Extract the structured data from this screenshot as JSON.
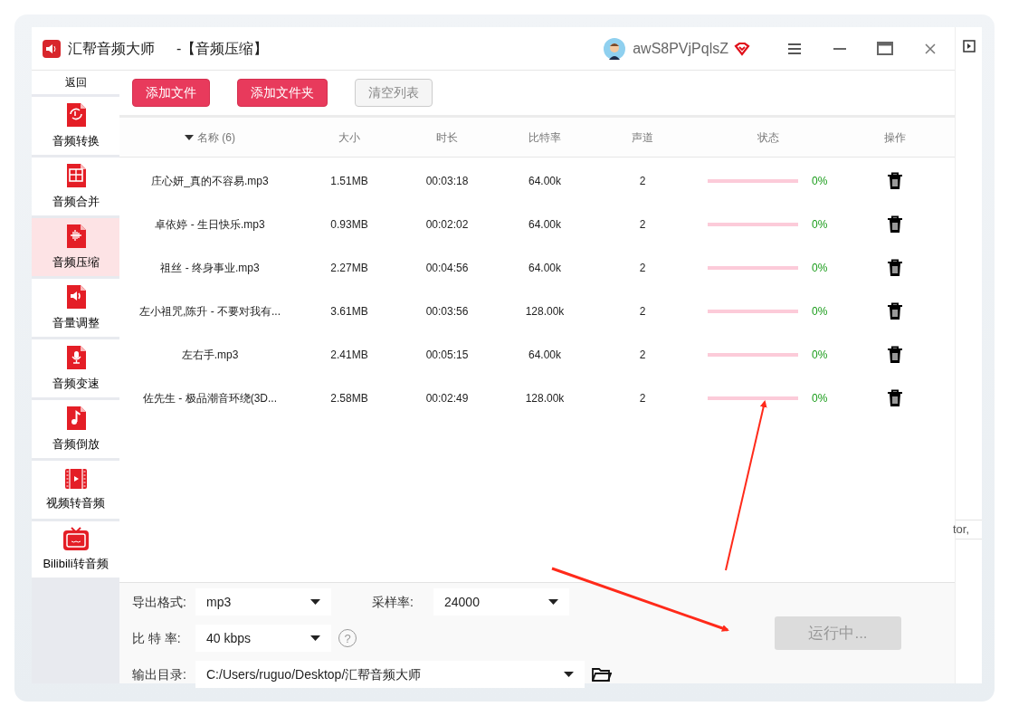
{
  "window": {
    "title": "汇帮音频大师",
    "subtitle": "-【音频压缩】"
  },
  "user": {
    "name": "awS8PVjPqlsZ"
  },
  "sidebar": {
    "back": "返回",
    "items": [
      {
        "label": "音频转换",
        "kind": "convert",
        "selected": false
      },
      {
        "label": "音频合并",
        "kind": "merge",
        "selected": false
      },
      {
        "label": "音频压缩",
        "kind": "compress",
        "selected": true
      },
      {
        "label": "音量调整",
        "kind": "volume",
        "selected": false
      },
      {
        "label": "音频变速",
        "kind": "speed",
        "selected": false
      },
      {
        "label": "音频倒放",
        "kind": "reverse",
        "selected": false
      },
      {
        "label": "视频转音频",
        "kind": "video",
        "selected": false
      },
      {
        "label": "Bilibili转音频",
        "kind": "tv",
        "selected": false
      }
    ]
  },
  "toolbar": {
    "buttons": [
      {
        "label": "添加文件",
        "kind": "primary"
      },
      {
        "label": "添加文件夹",
        "kind": "primary"
      },
      {
        "label": "清空列表",
        "kind": "secondary"
      }
    ]
  },
  "table": {
    "columns": [
      "名称 (6)",
      "大小",
      "时长",
      "比特率",
      "声道",
      "状态",
      "操作"
    ],
    "rows": [
      {
        "name": "庄心妍_真的不容易.mp3",
        "size": "1.51MB",
        "duration": "00:03:18",
        "bitrate": "64.00k",
        "channels": "2",
        "level": 0,
        "progress": "0%"
      },
      {
        "name": "卓依婷 - 生日快乐.mp3",
        "size": "0.93MB",
        "duration": "00:02:02",
        "bitrate": "64.00k",
        "channels": "2",
        "level": 0,
        "progress": "0%"
      },
      {
        "name": "祖丝 - 终身事业.mp3",
        "size": "2.27MB",
        "duration": "00:04:56",
        "bitrate": "64.00k",
        "channels": "2",
        "level": 0,
        "progress": "0%"
      },
      {
        "name": "左小祖咒,陈升 - 不要对我有...",
        "size": "3.61MB",
        "duration": "00:03:56",
        "bitrate": "128.00k",
        "channels": "2",
        "level": 0,
        "progress": "0%"
      },
      {
        "name": "左右手.mp3",
        "size": "2.41MB",
        "duration": "00:05:15",
        "bitrate": "64.00k",
        "channels": "2",
        "level": 0,
        "progress": "0%"
      },
      {
        "name": "佐先生 - 极品潮音环绕(3D...",
        "size": "2.58MB",
        "duration": "00:02:49",
        "bitrate": "128.00k",
        "channels": "2",
        "level": 0,
        "progress": "0%"
      }
    ]
  },
  "settings": {
    "format": {
      "label": "导出格式:",
      "value": "mp3"
    },
    "sample_rate": {
      "label": "采样率:",
      "value": "24000"
    },
    "bitrate": {
      "label": "比 特 率:",
      "value": "40 kbps",
      "help": "?"
    },
    "output_dir": {
      "label": "输出目录:",
      "value": "C:/Users/ruguo/Desktop/汇帮音频大师"
    }
  },
  "run_button": {
    "label": "运行中...",
    "disabled": true
  },
  "background_window": {
    "text": "tor,"
  }
}
